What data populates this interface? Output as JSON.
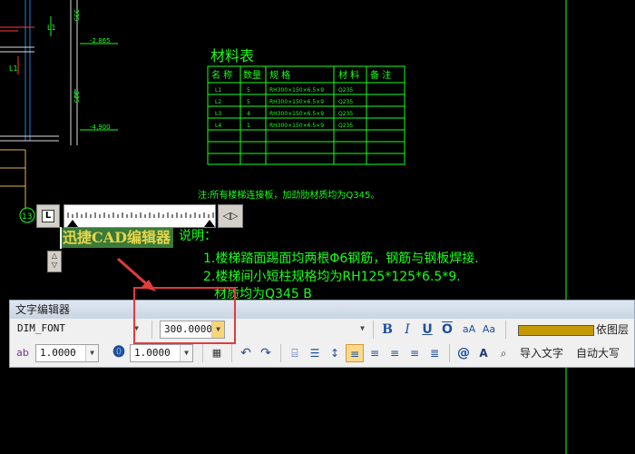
{
  "drawing": {
    "table_title": "材料表",
    "table_headers": [
      "名 称",
      "数量",
      "规    格",
      "材 料",
      "备 注"
    ],
    "table_rows": [
      [
        "L1",
        "5",
        "RH300×150×6.5×9",
        "Q235",
        ""
      ],
      [
        "L2",
        "5",
        "RH300×150×6.5×9",
        "Q235",
        ""
      ],
      [
        "L3",
        "4",
        "RH300×150×6.5×9",
        "Q235",
        ""
      ],
      [
        "L4",
        "1",
        "RH300×150×6.5×9",
        "Q235",
        ""
      ]
    ],
    "note": "注:所有楼梯连接板，加劲肋材质均为Q345。",
    "note_heading": "说明：",
    "note_lines": [
      "1.楼梯踏面踢面均两根Φ6钢筋，钢筋与钢板焊接.",
      "2.楼梯间小短柱规格均为RH125*125*6.5*9.",
      "材质均为Q345  B"
    ],
    "elevations": [
      "-2.865",
      "-4.900"
    ],
    "dims": [
      "335",
      "335"
    ],
    "grid_label": "13",
    "beam_labels": [
      "L1",
      "L1"
    ],
    "editing_text": "迅捷CAD编辑器"
  },
  "editor": {
    "title": "文字编辑器",
    "font": "DIM_FONT",
    "height": "300.0000",
    "layer_label": "依图层",
    "layer_color": "#c49a00",
    "width_factor": "1.0000",
    "oblique": "1.0000",
    "width_icon": "ab-width-icon",
    "import_text_label": "导入文字",
    "auto_label": "自动大写",
    "bold_label": "B",
    "italic_label": "I",
    "underline_label": "U",
    "overline_label": "O",
    "case_upper_label": "aA",
    "case_lower_label": "Aa",
    "width_icon_label": "ab",
    "at_label": "@",
    "font_icon_label": "A"
  },
  "highlight_color": "#e23b3b"
}
